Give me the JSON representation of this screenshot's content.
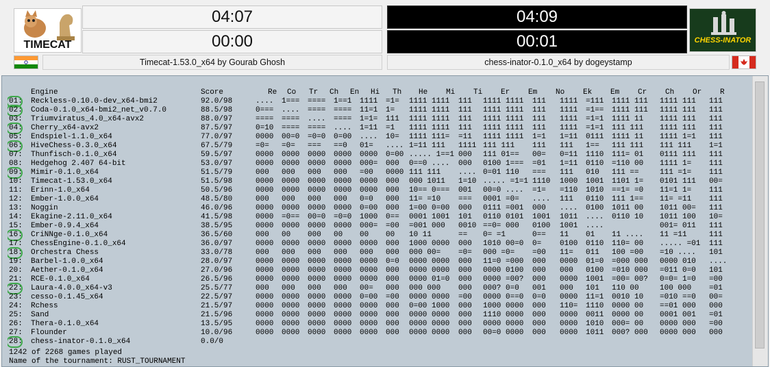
{
  "players": {
    "left": {
      "logo_text": "TIMECAT",
      "clock_main": "04:07",
      "clock_move": "00:00",
      "name": "Timecat-1.53.0_x64 by Gourab Ghosh"
    },
    "right": {
      "logo_text": "CHESS-INATOR",
      "clock_main": "04:09",
      "clock_move": "00:01",
      "name": "chess-inator-0.1.0_x64 by dogeystamp"
    }
  },
  "table": {
    "header": {
      "engine": "Engine",
      "score": "Score",
      "cols": [
        "Re",
        "Co",
        "Tr",
        "Ch",
        "En",
        "Hi",
        "Th",
        "He",
        "Mi",
        "Ti",
        "Er",
        "Em",
        "No",
        "Ek",
        "Em",
        "Cr",
        "Ch",
        "Or",
        "R"
      ]
    },
    "rows": [
      {
        "rank": "01:",
        "engine": "Reckless-0.10.0-dev_x64-bmi2",
        "score": "92.0/98",
        "cells": [
          "....",
          "1===",
          "====",
          "1==1",
          "1111",
          "=1=",
          "1111 1111",
          "111",
          "1111 1111",
          "111",
          "1111",
          "=111",
          "1111 111",
          "1111 111",
          "111"
        ]
      },
      {
        "rank": "02:",
        "engine": "Coda-0.1.0_x64-bmi2_net_v0.7.0",
        "score": "88.5/98",
        "cells": [
          "0===",
          "....",
          "====",
          "====",
          "11=1",
          "1=",
          "1111 1111",
          "111",
          "1111 1111",
          "111",
          "1111",
          "=1==",
          "1111 111",
          "1111 111",
          "111"
        ]
      },
      {
        "rank": "03:",
        "engine": "Triumviratus_4.0_x64-avx2",
        "score": "88.0/97",
        "cells": [
          "====",
          "====",
          "....",
          "====",
          "1=1=",
          "111",
          "1111 1111",
          "111",
          "1111 1111",
          "111",
          "1111",
          "=1=1",
          "1111 11",
          "1111 111",
          "111"
        ]
      },
      {
        "rank": "04:",
        "engine": "Cherry_x64-avx2",
        "score": "87.5/97",
        "cells": [
          "0=10",
          "====",
          "====",
          "....",
          "1=11",
          "=1",
          "1111 1111",
          "111",
          "1111 1111",
          "111",
          "1111",
          "=1=1",
          "111 111",
          "1111 111",
          "111"
        ]
      },
      {
        "rank": "05:",
        "engine": "Endspiel-1.1.0_x64",
        "score": "77.0/97",
        "cells": [
          "0000",
          "00=0",
          "=0=0",
          "0=00",
          "....",
          "10=",
          "1111 111=",
          "=11",
          "1111 1111",
          "1=1",
          "1=11",
          "0111",
          "1111 11",
          "1111 1=1",
          "111"
        ]
      },
      {
        "rank": "06:",
        "engine": "HiveChess-0.3.0_x64",
        "score": "67.5/79",
        "cells": [
          "=0=",
          "=0=",
          "===",
          "==0",
          "01=",
          "....",
          "1=11 111",
          "1111",
          "111 111",
          "111",
          "111",
          "1==",
          "111 111",
          "111 111",
          "1=1"
        ]
      },
      {
        "rank": "07:",
        "engine": "Thunfisch-0.1.0_x64",
        "score": "59.5/97",
        "cells": [
          "0000",
          "0000",
          "0000",
          "0000",
          "0000",
          "0=00",
          "..... 1==1",
          "000",
          "111 01==",
          "00=",
          "0=11",
          "1110",
          "111= 01",
          "0111 111",
          "111"
        ]
      },
      {
        "rank": "08:",
        "engine": "Hedgehog 2.407 64-bit",
        "score": "53.0/97",
        "cells": [
          "0000",
          "0000",
          "0000",
          "0000",
          "000=",
          "000",
          "0==0 ....",
          "000",
          "0100 1===",
          "=01",
          "1=11",
          "0110",
          "=110 00",
          "1111 1=",
          "111"
        ]
      },
      {
        "rank": "09:",
        "engine": "Mimir-0.1.0_x64",
        "score": "51.5/79",
        "cells": [
          "000",
          "000",
          "000",
          "000",
          "=00",
          "0000",
          "111 111",
          "....",
          "0=01 110",
          "===",
          "111",
          "010",
          "111 ==",
          "111 =1=",
          "111"
        ]
      },
      {
        "rank": "10:",
        "engine": "Timecat-1.53.0_x64",
        "score": "51.5/98",
        "cells": [
          "0000",
          "0000",
          "0000",
          "0000",
          "0000",
          "000",
          "000 1011",
          "1=10",
          "..... =1=1",
          "1110",
          "1000",
          "1001",
          "1101 1=",
          "0101 111",
          "00="
        ]
      },
      {
        "rank": "11:",
        "engine": "Erinn-1.0_x64",
        "score": "50.5/96",
        "cells": [
          "0000",
          "0000",
          "0000",
          "0000",
          "0000",
          "000",
          "10== 0===",
          "001",
          "00=0 ....",
          "=1=",
          "=110",
          "1010",
          "==1= =0",
          "11=1 1=",
          "111"
        ]
      },
      {
        "rank": "12:",
        "engine": "Ember-1.0.0_x64",
        "score": "48.5/80",
        "cells": [
          "000",
          "000",
          "000",
          "000",
          "0=0",
          "000",
          "11= =10",
          "===",
          "0001 =0=",
          "....",
          "111",
          "0110",
          "111 1==",
          "11= =11",
          "111"
        ]
      },
      {
        "rank": "13:",
        "engine": "Noggin",
        "score": "46.0/96",
        "cells": [
          "0000",
          "0000",
          "0000",
          "0000",
          "0=00",
          "000",
          "1=00 0=00",
          "000",
          "0111 =001",
          "000",
          "....",
          "0100",
          "1011 00",
          "1011 00=",
          "111"
        ]
      },
      {
        "rank": "14:",
        "engine": "Ekagine-2.11.0_x64",
        "score": "41.5/98",
        "cells": [
          "0000",
          "=0==",
          "00=0",
          "=0=0",
          "1000",
          "0==",
          "0001 1001",
          "101",
          "0110 0101",
          "1001",
          "1011",
          "....",
          "0110 10",
          "1011 100",
          "10="
        ]
      },
      {
        "rank": "15:",
        "engine": "Ember-0.9.4_x64",
        "score": "38.5/95",
        "cells": [
          "0000",
          "0000",
          "0000",
          "0000",
          "000=",
          "=00",
          "=001 000",
          "0010",
          "==0= 000",
          "0100",
          "1001",
          "....",
          "",
          "001= 011",
          "111"
        ]
      },
      {
        "rank": "16:",
        "engine": "CriNNge-0.1.0_x64",
        "score": "36.5/60",
        "cells": [
          "000",
          "00",
          "000",
          "00",
          "00",
          "00",
          "10 11",
          "==",
          "0= =1",
          "0==",
          "11",
          "01",
          "11 ....",
          "11 =11",
          "111"
        ]
      },
      {
        "rank": "17:",
        "engine": "ChessEngine-0.1.0_x64",
        "score": "36.0/97",
        "cells": [
          "0000",
          "0000",
          "0000",
          "0000",
          "0000",
          "000",
          "1000 0000",
          "000",
          "1010 00=0",
          "0=",
          "0100",
          "0110",
          "110= 00",
          "..... =01",
          "111"
        ]
      },
      {
        "rank": "18:",
        "engine": "Orchestra Chess",
        "score": "33.0/78",
        "cells": [
          "000",
          "000",
          "000",
          "000",
          "000",
          "000",
          "000 00=",
          "=0=",
          "000 =0=",
          "=00",
          "11=",
          "011",
          "100 =00",
          "=10 ....",
          "101"
        ]
      },
      {
        "rank": "19:",
        "engine": "Barbel-1.0.0_x64",
        "score": "28.0/97",
        "cells": [
          "0000",
          "0000",
          "0000",
          "0000",
          "0000",
          "0=0",
          "0000 0000",
          "000",
          "11=0 =000",
          "000",
          "0000",
          "01=0",
          "=000 000",
          "0000 010",
          "...."
        ]
      },
      {
        "rank": "20:",
        "engine": "Aether-0.1.0_x64",
        "score": "27.0/96",
        "cells": [
          "0000",
          "0000",
          "0000",
          "0000",
          "0000",
          "000",
          "0000 0000",
          "000",
          "0000 0100",
          "000",
          "000",
          "0100",
          "=010 000",
          "=011 0=0",
          "101"
        ]
      },
      {
        "rank": "21:",
        "engine": "RCE-0.1.0_x64",
        "score": "26.5/96",
        "cells": [
          "0000",
          "0000",
          "0000",
          "0000",
          "0000",
          "000",
          "0000 01=0",
          "000",
          "0000 =00?",
          "000",
          "0000",
          "1001",
          "=00= 00?",
          "0=0= 1=0",
          "=00"
        ]
      },
      {
        "rank": "22:",
        "engine": "Laura-4.0.0_x64-v3",
        "score": "25.5/77",
        "cells": [
          "000",
          "000",
          "000",
          "000",
          "00=",
          "000",
          "000 000",
          "000",
          "000? 0=0",
          "001",
          "000",
          "101",
          "110 00",
          "100 000",
          "=01"
        ]
      },
      {
        "rank": "23:",
        "engine": "cesso-0.1.45_x64",
        "score": "22.5/97",
        "cells": [
          "0000",
          "0000",
          "0000",
          "0000",
          "0=00",
          "=00",
          "0000 0000",
          "=00",
          "0000 0==0",
          "0=0",
          "0000",
          "11=1",
          "0010 10",
          "=010 ==0",
          "00="
        ]
      },
      {
        "rank": "24:",
        "engine": "Rchess",
        "score": "21.5/97",
        "cells": [
          "0000",
          "0000",
          "0000",
          "0000",
          "0000",
          "000",
          "0=00 1000",
          "000",
          "1000 0000",
          "000",
          "110=",
          "1110",
          "0000 00",
          "==01 000",
          "000"
        ]
      },
      {
        "rank": "25:",
        "engine": "Sand",
        "score": "21.5/96",
        "cells": [
          "0000",
          "0000",
          "0000",
          "0000",
          "0000",
          "000",
          "0000 0000",
          "000",
          "1110 0000",
          "000",
          "0000",
          "0011",
          "0000 00",
          "0001 001",
          "=01"
        ]
      },
      {
        "rank": "26:",
        "engine": "Thera-0.1.0_x64",
        "score": "13.5/95",
        "cells": [
          "0000",
          "0000",
          "0000",
          "0000",
          "0000",
          "000",
          "0000 0000",
          "000",
          "0000 0000",
          "000",
          "0000",
          "1010",
          "000= 00",
          "0000 000",
          "=00"
        ]
      },
      {
        "rank": "27:",
        "engine": "Flounder",
        "score": "10.0/96",
        "cells": [
          "0000",
          "0000",
          "0000",
          "0000",
          "0000",
          "000",
          "0000 0000",
          "000",
          "00=0 0000",
          "000",
          "0000",
          "1011",
          "000? 000",
          "0000 000",
          "000"
        ]
      },
      {
        "rank": "28:",
        "engine": "chess-inator-0.1.0_x64",
        "score": "0.0/0",
        "cells": [
          "",
          "",
          "",
          "",
          "",
          "",
          "",
          "",
          "",
          "",
          "",
          "",
          "",
          "",
          ""
        ]
      }
    ]
  },
  "footer": {
    "games": "1242 of 2268 games played",
    "tournament": "Name of the tournament: RUST_TOURNAMENT"
  },
  "colors": {
    "marker": "#3da84a",
    "panel": "#c0cbd4"
  }
}
